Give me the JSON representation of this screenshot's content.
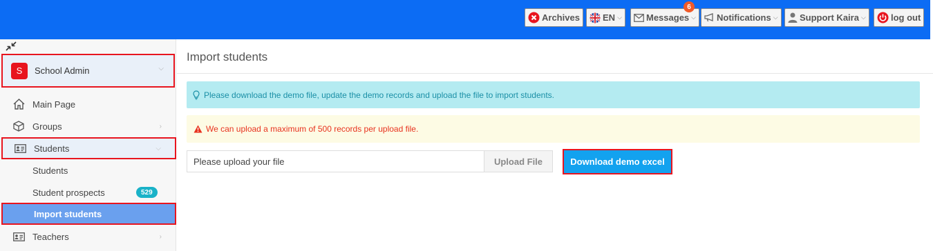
{
  "colors": {
    "topbar": "#0c6cf4",
    "highlight_border": "#e8141e",
    "active_item": "#6aa0ee",
    "info_bg": "#b4ebf1",
    "warn_bg": "#fdfbe4",
    "primary_button": "#13a2ef"
  },
  "topbar": {
    "archives_label": "Archives",
    "language_label": "EN",
    "messages_label": "Messages",
    "messages_count": "6",
    "notifications_label": "Notifications",
    "user_label": "Support Kaira",
    "logout_label": "log out",
    "icons": [
      "close-circle-icon",
      "uk-flag-icon",
      "envelope-icon",
      "megaphone-icon",
      "user-icon",
      "power-icon"
    ]
  },
  "sidebar": {
    "school": {
      "avatar_letter": "S",
      "label": "School Admin"
    },
    "items": [
      {
        "label": "Main Page",
        "icon": "home-icon"
      },
      {
        "label": "Groups",
        "icon": "cube-icon"
      },
      {
        "label": "Students",
        "icon": "id-card-icon"
      },
      {
        "label": "Students"
      },
      {
        "label": "Student prospects",
        "count": "529"
      },
      {
        "label": "Import students"
      },
      {
        "label": "Teachers",
        "icon": "id-card-icon"
      }
    ]
  },
  "main": {
    "title": "Import students",
    "info_text": "Please download the demo file, update the demo records and upload the file to import students.",
    "warning_text": "We can upload a maximum of 500 records per upload file.",
    "file_placeholder": "Please upload your file",
    "upload_label": "Upload File",
    "download_label": "Download demo excel"
  }
}
